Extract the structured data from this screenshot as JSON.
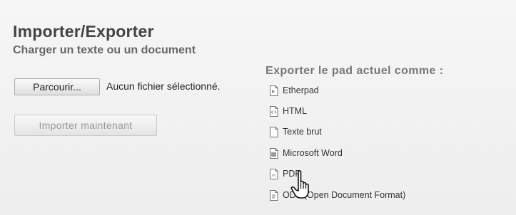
{
  "header": {
    "title": "Importer/Exporter",
    "subtitle": "Charger un texte ou un document"
  },
  "import": {
    "browse_label": "Parcourir...",
    "file_status": "Aucun fichier sélectionné.",
    "import_button": "Importer maintenant"
  },
  "export": {
    "heading": "Exporter le pad actuel comme :",
    "items": [
      {
        "label": "Etherpad",
        "icon": "etherpad-file-icon"
      },
      {
        "label": "HTML",
        "icon": "html-file-icon"
      },
      {
        "label": "Texte brut",
        "icon": "text-file-icon"
      },
      {
        "label": "Microsoft Word",
        "icon": "word-file-icon"
      },
      {
        "label": "PDF",
        "icon": "pdf-file-icon"
      },
      {
        "label": "ODF (Open Document Format)",
        "icon": "odf-file-icon"
      }
    ]
  },
  "colors": {
    "background": "#f1f1f1",
    "title": "#444444",
    "subtitle": "#666666"
  }
}
